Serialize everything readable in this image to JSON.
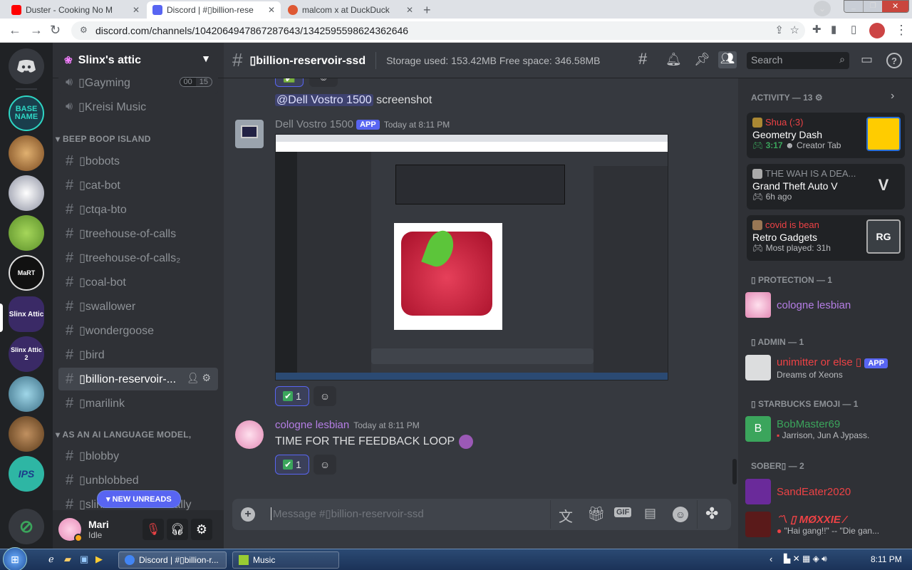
{
  "browser": {
    "tabs": [
      {
        "label": "Duster - Cooking No M",
        "active": false
      },
      {
        "label": "Discord | #▯billion-rese",
        "active": true
      },
      {
        "label": "malcom x at DuckDuck",
        "active": false
      }
    ],
    "url": "discord.com/channels/1042064947867287643/1342595598624362646"
  },
  "server": {
    "name": "Slinx's attic",
    "voice_channels": [
      {
        "label": "▯Gayming",
        "counts": [
          "00",
          "15"
        ]
      },
      {
        "label": "▯Kreisi Music"
      }
    ],
    "categories": [
      {
        "label": "BEEP BOOP ISLAND"
      },
      {
        "label": "AS AN AI LANGUAGE MODEL,"
      }
    ],
    "channels_a": [
      "▯bobots",
      "▯cat-bot",
      "▯ctqa-bto",
      "▯treehouse-of-calls",
      "▯treehouse-of-calls₂",
      "▯coal-bot",
      "▯swallower",
      "▯wondergoose",
      "▯bird",
      "▯billion-reservoir-...",
      "▯marilink"
    ],
    "channels_b": [
      "▯blobby",
      "▯unblobbed",
      "▯slinx92-but-not-really"
    ],
    "new_unreads": "NEW UNREADS",
    "guild_labels": [
      "BASE NAME",
      "Slinx Attic",
      "Slinx Attic 2",
      "IPS"
    ]
  },
  "user": {
    "name": "Mari",
    "status": "Idle"
  },
  "channel": {
    "name": "▯billion-reservoir-ssd",
    "topic": "Storage used: 153.42MB Free space: 346.58MB",
    "search_placeholder": "Search",
    "composer_placeholder": "Message #▯billion-reservoir-ssd"
  },
  "messages": [
    {
      "mention": "@Dell Vostro 1500",
      "text": "screenshot"
    },
    {
      "author": "Dell Vostro 1500",
      "badge": "APP",
      "time": "Today at 8:11 PM",
      "reaction": "1"
    },
    {
      "author": "cologne lesbian",
      "time": "Today at 8:11 PM",
      "text": "TIME FOR THE FEEDBACK LOOP",
      "reaction": "1"
    }
  ],
  "members": {
    "activity_header": "ACTIVITY — 13",
    "activities": [
      {
        "user": "Shua (:3)",
        "game": "Geometry Dash",
        "detail1": "3:17",
        "detail2": "Creator Tab"
      },
      {
        "user": "THE WAH IS A DEA...",
        "game": "Grand Theft Auto V",
        "detail1": "6h ago"
      },
      {
        "user": "covid is bean",
        "game": "Retro Gadgets",
        "detail1": "Most played: 31h",
        "art": "RG"
      }
    ],
    "groups": [
      {
        "label": "▯ PROTECTION — 1",
        "members": [
          {
            "name": "cologne lesbian",
            "color": "#b57ee5"
          }
        ]
      },
      {
        "label": "▯ ADMIN — 1",
        "members": [
          {
            "name": "unimitter or else ▯",
            "badge": "APP",
            "sub": "Dreams of Xeons",
            "color": "#ed4245"
          }
        ]
      },
      {
        "label": "▯ STARBUCKS EMOJI — 1",
        "members": [
          {
            "name": "BobMaster69",
            "sub": "Jarrison, Jun A Jypass.",
            "color": "#3ba55c",
            "initial": "B"
          }
        ]
      },
      {
        "label": "SOBER▯ — 2",
        "members": [
          {
            "name": "SandEater2020",
            "color": "#ed4245"
          },
          {
            "name": "〽 ▯ MØXXIE ⁄",
            "sub": "\"Hai gang!!\" -- \"Die gan...",
            "color": "#ed4245"
          }
        ]
      }
    ]
  },
  "taskbar": {
    "items": [
      "Discord | #▯billion-r...",
      "Music"
    ],
    "time": "8:11 PM"
  },
  "colors": {
    "blurple": "#5865f2",
    "bg": "#36393f",
    "sidebar": "#2f3136",
    "guilds": "#202225"
  }
}
